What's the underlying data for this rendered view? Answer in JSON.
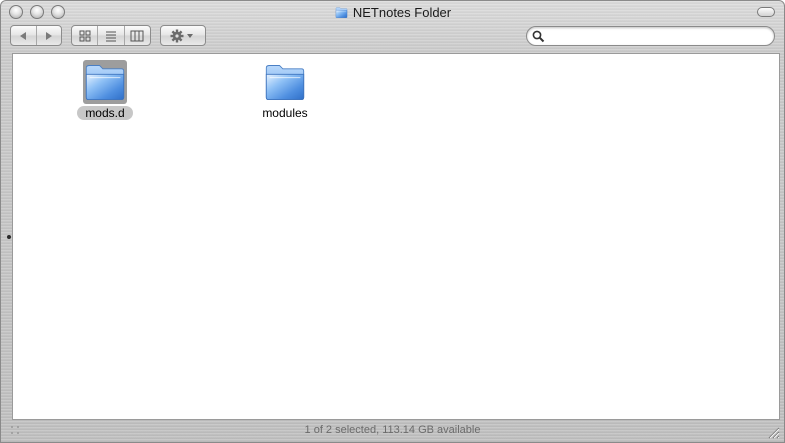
{
  "window": {
    "title": "NETnotes Folder"
  },
  "toolbar": {
    "nav": [
      {
        "icon": "back-arrow-icon"
      },
      {
        "icon": "forward-arrow-icon"
      }
    ],
    "views": [
      {
        "icon": "icon-view-icon"
      },
      {
        "icon": "list-view-icon"
      },
      {
        "icon": "column-view-icon"
      }
    ],
    "action_icon": "gear-icon",
    "search": {
      "value": "",
      "placeholder": ""
    }
  },
  "items": [
    {
      "name": "mods.d",
      "selected": true,
      "icon": "folder-icon"
    },
    {
      "name": "modules",
      "selected": false,
      "icon": "folder-icon"
    }
  ],
  "status": {
    "text": "1 of 2 selected, 113.14 GB available"
  },
  "colors": {
    "folder_blue": "#5f9ee8",
    "selection_gray": "#9d9d9d",
    "label_selection": "#c7c7c7"
  }
}
